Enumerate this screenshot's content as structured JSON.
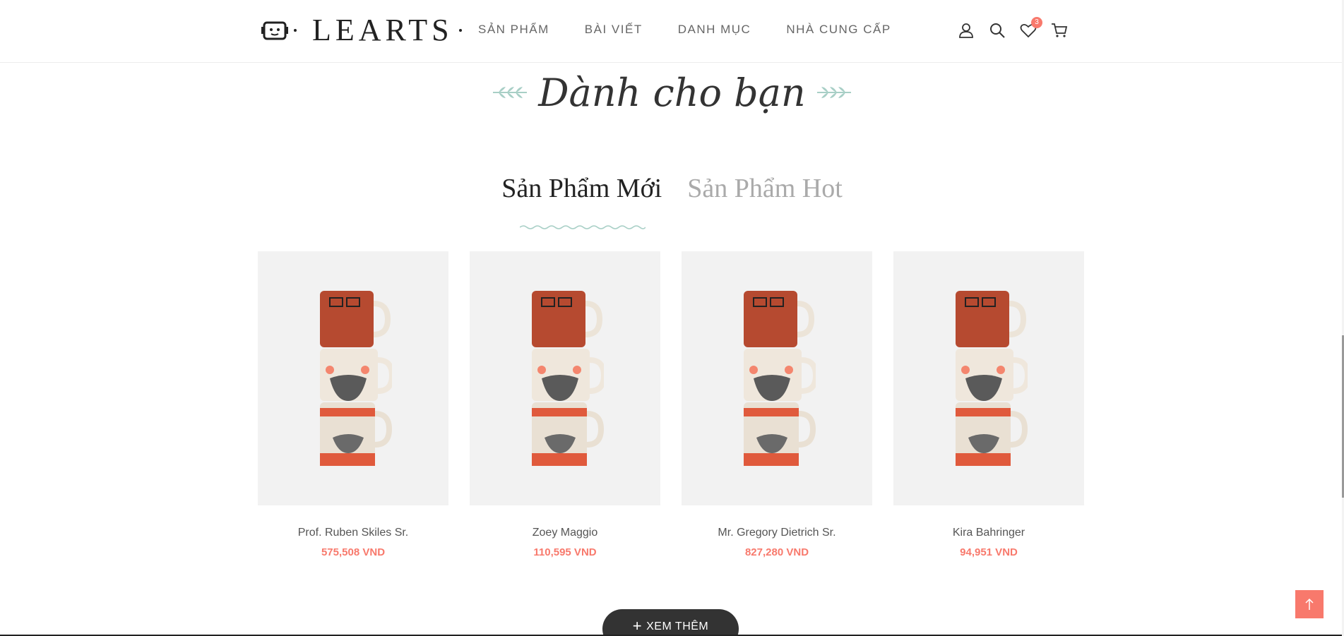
{
  "header": {
    "logo_text": "LEARTS",
    "nav": [
      "SẢN PHẨM",
      "BÀI VIẾT",
      "DANH MỤC",
      "NHÀ CUNG CẤP"
    ],
    "wishlist_count": "3"
  },
  "section": {
    "title": "Dành cho bạn"
  },
  "tabs": {
    "new": "Sản Phẩm Mới",
    "hot": "Sản Phẩm Hot"
  },
  "products": [
    {
      "name": "Prof. Ruben Skiles Sr.",
      "price": "575,508 VND"
    },
    {
      "name": "Zoey Maggio",
      "price": "110,595 VND"
    },
    {
      "name": "Mr. Gregory Dietrich Sr.",
      "price": "827,280 VND"
    },
    {
      "name": "Kira Bahringer",
      "price": "94,951 VND"
    }
  ],
  "more_button": "XEM THÊM",
  "colors": {
    "accent": "#f8796c",
    "leaf": "#a8cfc6",
    "dark": "#333333"
  }
}
